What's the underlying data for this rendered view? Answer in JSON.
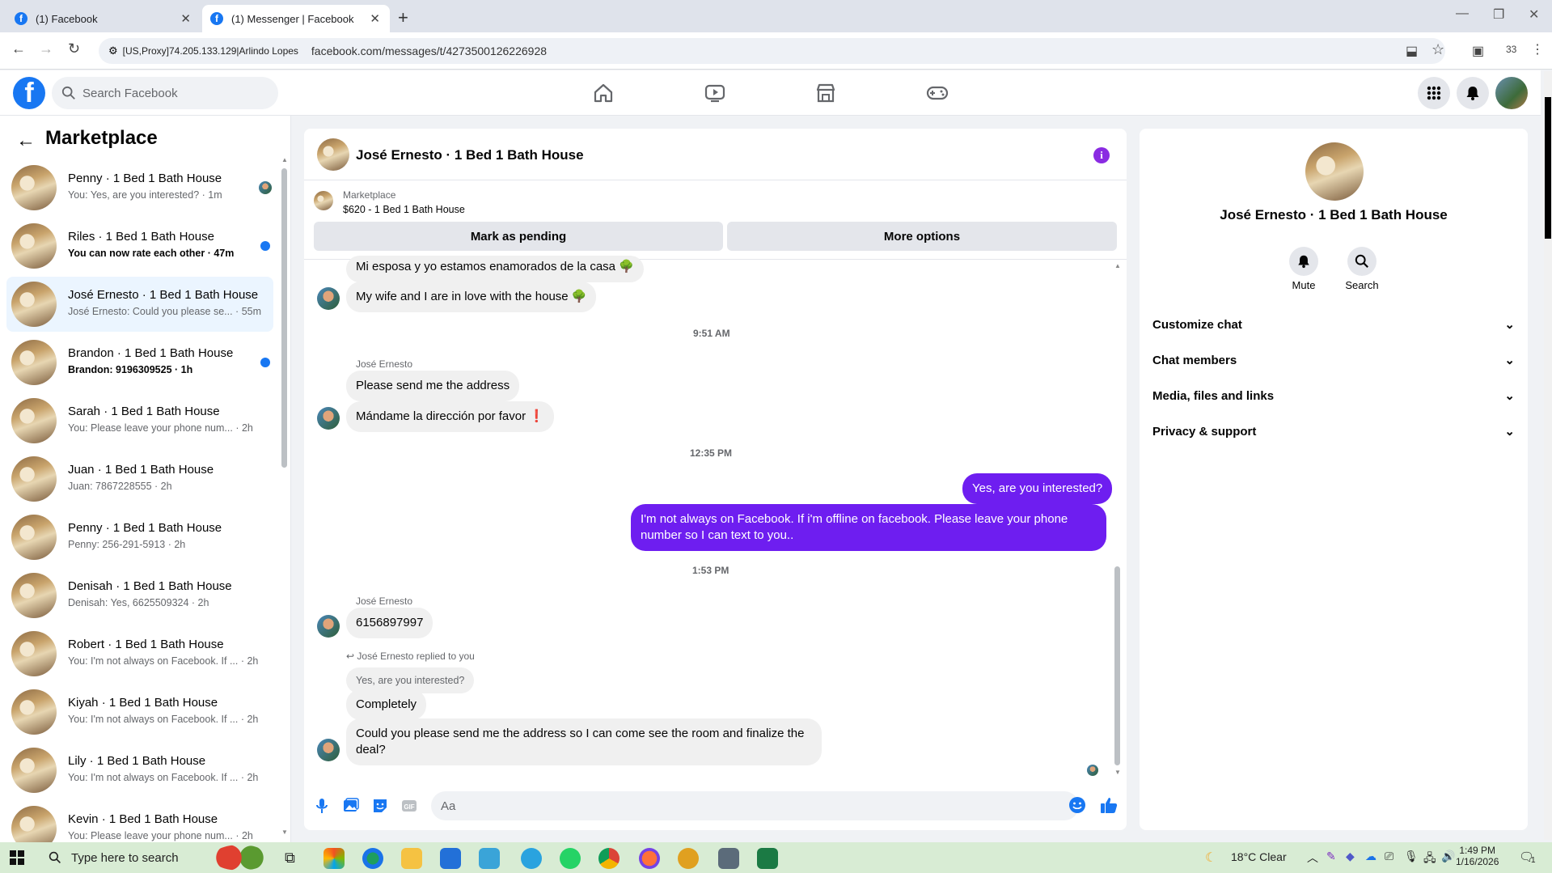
{
  "browser": {
    "tabs": [
      {
        "title": "(1) Facebook"
      },
      {
        "title": "(1) Messenger | Facebook"
      }
    ],
    "proxy_label": "[US,Proxy]74.205.133.129|Arlindo Lopes",
    "url": "facebook.com/messages/t/4273500126226928",
    "extensions_count": "33"
  },
  "facebook": {
    "logo": "f",
    "search_placeholder": "Search Facebook"
  },
  "sidebar": {
    "title": "Marketplace",
    "conversations": [
      {
        "name": "Penny · 1 Bed 1 Bath House",
        "preview": "You: Yes, are you interested? · 1m",
        "unread": false,
        "selected": false
      },
      {
        "name": "Riles · 1 Bed 1 Bath House",
        "preview": "You can now rate each other · 47m",
        "unread": true,
        "selected": false
      },
      {
        "name": "José Ernesto · 1 Bed 1 Bath House",
        "preview": "José Ernesto: Could you please se... · 55m",
        "unread": false,
        "selected": true
      },
      {
        "name": "Brandon · 1 Bed 1 Bath House",
        "preview": "Brandon: 9196309525 · 1h",
        "unread": true,
        "selected": false
      },
      {
        "name": "Sarah · 1 Bed 1 Bath House",
        "preview": "You: Please leave your phone num... · 2h",
        "unread": false,
        "selected": false
      },
      {
        "name": "Juan · 1 Bed 1 Bath House",
        "preview": "Juan: 7867228555 · 2h",
        "unread": false,
        "selected": false
      },
      {
        "name": "Penny · 1 Bed 1 Bath House",
        "preview": "Penny: 256-291-5913 · 2h",
        "unread": false,
        "selected": false
      },
      {
        "name": "Denisah · 1 Bed 1 Bath House",
        "preview": "Denisah: Yes, 6625509324 · 2h",
        "unread": false,
        "selected": false
      },
      {
        "name": "Robert · 1 Bed 1 Bath House",
        "preview": "You: I'm not always on Facebook. If ... · 2h",
        "unread": false,
        "selected": false
      },
      {
        "name": "Kiyah · 1 Bed 1 Bath House",
        "preview": "You: I'm not always on Facebook. If ... · 2h",
        "unread": false,
        "selected": false
      },
      {
        "name": "Lily · 1 Bed 1 Bath House",
        "preview": "You: I'm not always on Facebook. If ... · 2h",
        "unread": false,
        "selected": false
      },
      {
        "name": "Kevin · 1 Bed 1 Bath House",
        "preview": "You: Please leave your phone num... · 2h",
        "unread": false,
        "selected": false
      }
    ]
  },
  "chat": {
    "title": "José Ernesto · 1 Bed 1 Bath House",
    "listing_source": "Marketplace",
    "listing_price": "$620 - 1 Bed 1 Bath House",
    "mark_pending_label": "Mark as pending",
    "more_options_label": "More options",
    "messages": {
      "m1": "Mi esposa y yo estamos enamorados de la casa 🌳",
      "m2": "My wife and I are in love with the house 🌳",
      "time1": "9:51 AM",
      "sender1": "José Ernesto",
      "m3": "Please send me the address",
      "m4": "Mándame la dirección por favor ❗",
      "time2": "12:35 PM",
      "out1": "Yes, are you interested?",
      "out2_line1": "I'm not always on Facebook. If i'm offline on facebook. Please leave your phone",
      "out2_line2": "number so I can text to you..",
      "time3": "1:53 PM",
      "sender2": "José Ernesto",
      "m5": "6156897997",
      "reply_header": "José Ernesto replied to you",
      "reply_quote": "Yes, are you interested?",
      "m6": "Completely",
      "m7_line1": "Could you please send me the address so I can come see the room and finalize the",
      "m7_line2": "deal?"
    },
    "composer_placeholder": "Aa"
  },
  "details": {
    "name": "José Ernesto · 1 Bed 1 Bath House",
    "mute_label": "Mute",
    "search_label": "Search",
    "sections": [
      "Customize chat",
      "Chat members",
      "Media, files and links",
      "Privacy & support"
    ]
  },
  "taskbar": {
    "search_placeholder": "Type here to search",
    "weather": "18°C  Clear",
    "time": "1:49 PM",
    "date": "1/16/2026",
    "notification_count": "1"
  },
  "colors": {
    "accent": "#1877f2",
    "outgoing_bubble": "#6e1ef0",
    "info_icon": "#8a2be2"
  }
}
